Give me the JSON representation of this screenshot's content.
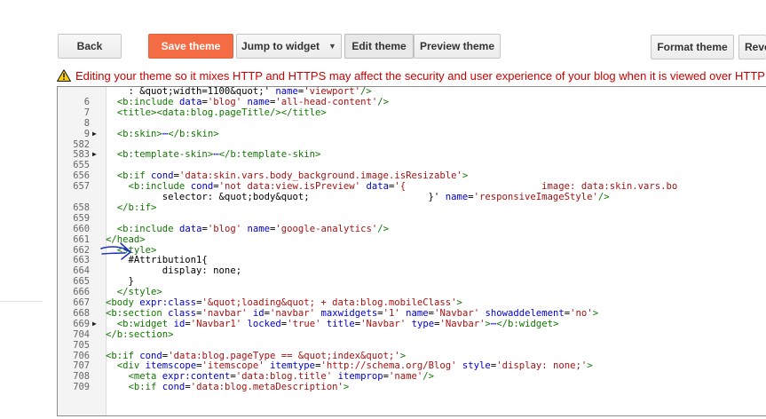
{
  "toolbar": {
    "back_label": "Back",
    "save_label": "Save theme",
    "jump_label": "Jump to widget",
    "edit_label": "Edit theme",
    "preview_label": "Preview theme",
    "format_label": "Format theme",
    "revert_label": "Reve"
  },
  "warning": {
    "icon": "warning-triangle-icon",
    "text": "Editing your theme so it mixes HTTP and HTTPS may affect the security and user experience of your blog when it is viewed over HTTP"
  },
  "colors": {
    "save_button": "#f36c44",
    "warning_text": "#cc0000",
    "highlight": "#ffff44",
    "annotation": "#2233bb"
  },
  "editor": {
    "lines": [
      {
        "num": "",
        "fold": false,
        "text": "    : &quot;width=1100&quot;' name='viewport'/>"
      },
      {
        "num": "6",
        "fold": false,
        "text": "  <b:include data='blog' name='all-head-content'/>"
      },
      {
        "num": "7",
        "fold": false,
        "text": "  <title><data:blog.pageTitle/></title>"
      },
      {
        "num": "8",
        "fold": false,
        "text": ""
      },
      {
        "num": "9",
        "fold": true,
        "text": "  <b:skin>⋯</b:skin>"
      },
      {
        "num": "582",
        "fold": false,
        "text": ""
      },
      {
        "num": "583",
        "fold": true,
        "text": "  <b:template-skin>⋯</b:template-skin>"
      },
      {
        "num": "655",
        "fold": false,
        "text": ""
      },
      {
        "num": "656",
        "fold": false,
        "text": "  <b:if cond='data:skin.vars.body_background.image.isResizable'>"
      },
      {
        "num": "657",
        "fold": false,
        "text": "    <b:include cond='not data:view.isPreview' data='{                        image: data:skin.vars.bo"
      },
      {
        "num": "",
        "fold": false,
        "text": "          selector: &quot;body&quot;                     }' name='responsiveImageStyle'/>"
      },
      {
        "num": "658",
        "fold": false,
        "text": "  </b:if>"
      },
      {
        "num": "659",
        "fold": false,
        "text": ""
      },
      {
        "num": "660",
        "fold": false,
        "text": "  <b:include data='blog' name='google-analytics'/>"
      },
      {
        "num": "661",
        "fold": false,
        "text": "</head>"
      },
      {
        "num": "662",
        "fold": false,
        "text": "  <style>"
      },
      {
        "num": "663",
        "fold": false,
        "text": "    #Attribution1{"
      },
      {
        "num": "664",
        "fold": false,
        "text": "          display: none;"
      },
      {
        "num": "665",
        "fold": false,
        "text": "    }"
      },
      {
        "num": "666",
        "fold": false,
        "text": "  </style>"
      },
      {
        "num": "667",
        "fold": false,
        "text": "<body expr:class='&quot;loading&quot; + data:blog.mobileClass'>"
      },
      {
        "num": "668",
        "fold": false,
        "text": "<b:section class='navbar' id='navbar' maxwidgets='1' name='Navbar' showaddelement='no'>"
      },
      {
        "num": "669",
        "fold": true,
        "text": "  <b:widget id='Navbar1' locked='true' title='Navbar' type='Navbar'>⋯</b:widget>"
      },
      {
        "num": "704",
        "fold": false,
        "text": "</b:section>"
      },
      {
        "num": "705",
        "fold": false,
        "text": ""
      },
      {
        "num": "706",
        "fold": false,
        "text": "<b:if cond='data:blog.pageType == &quot;index&quot;'>"
      },
      {
        "num": "707",
        "fold": false,
        "text": "  <div itemscope='itemscope' itemtype='http://schema.org/Blog' style='display: none;'>"
      },
      {
        "num": "708",
        "fold": false,
        "text": "    <meta expr:content='data:blog.title' itemprop='name'/>"
      },
      {
        "num": "709",
        "fold": false,
        "text": "    <b:if cond='data:blog.metaDescription'>"
      }
    ]
  }
}
